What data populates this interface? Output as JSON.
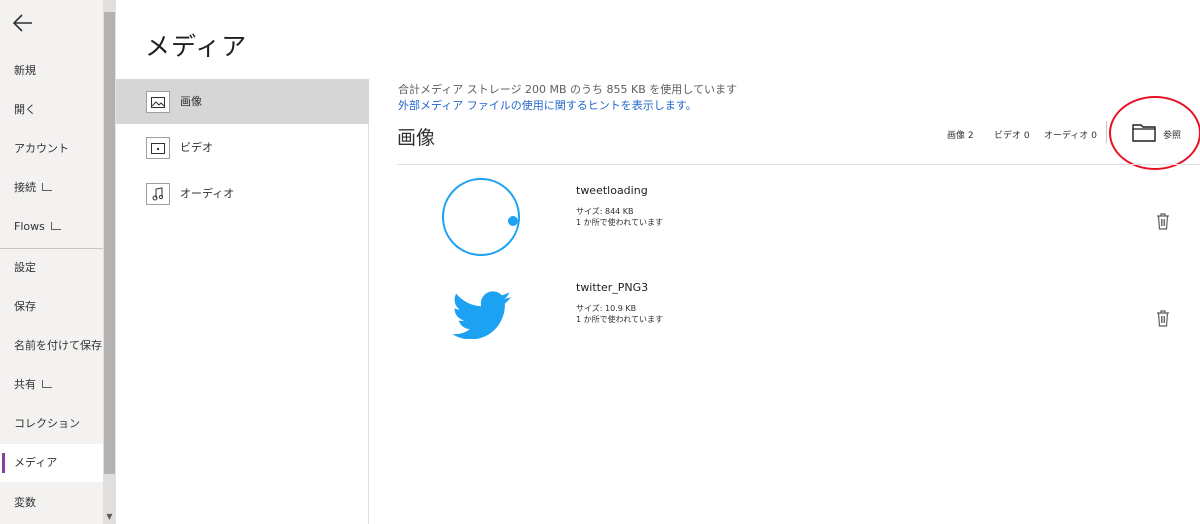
{
  "nav": {
    "items": [
      {
        "label": "新規"
      },
      {
        "label": "開く"
      },
      {
        "label": "アカウント"
      },
      {
        "label": "接続"
      },
      {
        "label": "Flows"
      },
      {
        "label": "設定"
      },
      {
        "label": "保存"
      },
      {
        "label": "名前を付けて保存"
      },
      {
        "label": "共有"
      },
      {
        "label": "コレクション"
      },
      {
        "label": "メディア"
      },
      {
        "label": "変数"
      }
    ]
  },
  "page": {
    "title": "メディア"
  },
  "media_types": [
    {
      "label": "画像",
      "icon": "image-icon"
    },
    {
      "label": "ビデオ",
      "icon": "video-icon"
    },
    {
      "label": "オーディオ",
      "icon": "audio-icon"
    }
  ],
  "storage": {
    "usage": "合計メディア ストレージ 200 MB のうち 855 KB を使用しています",
    "hint_link": "外部メディア ファイルの使用に関するヒントを表示します。"
  },
  "section": {
    "title": "画像",
    "counts": {
      "images": "画像 2",
      "videos": "ビデオ 0",
      "audio": "オーディオ 0"
    },
    "browse_label": "参照"
  },
  "files": [
    {
      "name": "tweetloading",
      "size": "サイズ: 844 KB",
      "usage": "1 か所で使われています"
    },
    {
      "name": "twitter_PNG3",
      "size": "サイズ: 10.9 KB",
      "usage": "1 か所で使われています"
    }
  ],
  "colors": {
    "accent": "#8a3f9e",
    "link": "#2266cc",
    "highlight": "#e81123",
    "twitter_blue": "#1da1f2"
  }
}
